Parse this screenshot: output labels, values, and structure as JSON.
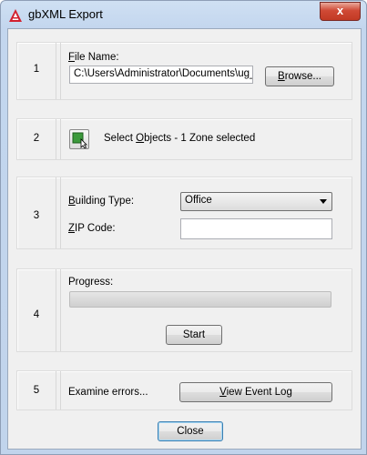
{
  "window": {
    "title": "gbXML Export",
    "close_glyph": "x"
  },
  "sections": {
    "s1": {
      "number": "1",
      "label_prefix": "F",
      "label_rest": "ile Name:",
      "value": "C:\\Users\\Administrator\\Documents\\ug_d",
      "browse_prefix": "B",
      "browse_rest": "rowse..."
    },
    "s2": {
      "number": "2",
      "text_prefix": "Select ",
      "text_ul": "O",
      "text_rest": "bjects - 1 Zone selected",
      "icon": "select-objects-icon"
    },
    "s3": {
      "number": "3",
      "building_type_ul": "B",
      "building_type_rest": "uilding Type:",
      "building_type_value": "Office",
      "zip_ul": "Z",
      "zip_rest": "IP Code:",
      "zip_value": ""
    },
    "s4": {
      "number": "4",
      "progress_label": "Progress:",
      "progress_fraction": 0,
      "start_label": "Start"
    },
    "s5": {
      "number": "5",
      "examine_label": "Examine errors...",
      "view_ul": "V",
      "view_rest": "iew Event Log"
    }
  },
  "footer": {
    "close_label": "Close"
  }
}
